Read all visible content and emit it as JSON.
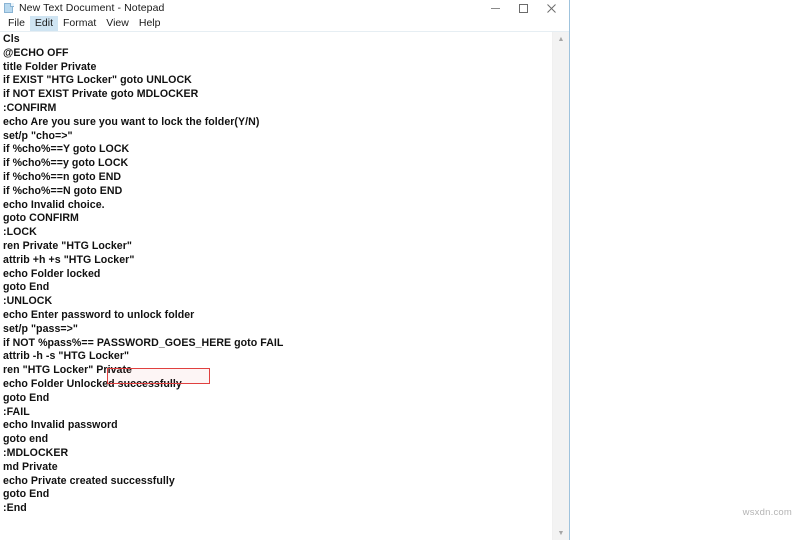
{
  "window": {
    "title": "New Text Document - Notepad",
    "icon": "notepad-document-icon",
    "controls": {
      "minimize_label": "–",
      "maximize_label": "□",
      "close_label": "✕"
    }
  },
  "menu": {
    "items": [
      {
        "label": "File",
        "active": false
      },
      {
        "label": "Edit",
        "active": true
      },
      {
        "label": "Format",
        "active": false
      },
      {
        "label": "View",
        "active": false
      },
      {
        "label": "Help",
        "active": false
      }
    ]
  },
  "editor": {
    "lines": [
      "Cls",
      "@ECHO OFF",
      "title Folder Private",
      "if EXIST \"HTG Locker\" goto UNLOCK",
      "if NOT EXIST Private goto MDLOCKER",
      ":CONFIRM",
      "echo Are you sure you want to lock the folder(Y/N)",
      "set/p \"cho=>\"",
      "if %cho%==Y goto LOCK",
      "if %cho%==y goto LOCK",
      "if %cho%==n goto END",
      "if %cho%==N goto END",
      "echo Invalid choice.",
      "goto CONFIRM",
      ":LOCK",
      "ren Private \"HTG Locker\"",
      "attrib +h +s \"HTG Locker\"",
      "echo Folder locked",
      "goto End",
      ":UNLOCK",
      "echo Enter password to unlock folder",
      "set/p \"pass=>\"",
      "if NOT %pass%== PASSWORD_GOES_HERE goto FAIL",
      "attrib -h -s \"HTG Locker\"",
      "ren \"HTG Locker\" Private",
      "echo Folder Unlocked successfully",
      "goto End",
      ":FAIL",
      "echo Invalid password",
      "goto end",
      ":MDLOCKER",
      "md Private",
      "echo Private created successfully",
      "goto End",
      ":End"
    ]
  },
  "annotation": {
    "highlight_text": "PASSWORD_GOES_HERE",
    "highlight_color": "#e0403f"
  },
  "scrollbar": {
    "up_arrow": "▲",
    "down_arrow": "▼"
  },
  "watermark": {
    "text": "wsxdn.com"
  }
}
